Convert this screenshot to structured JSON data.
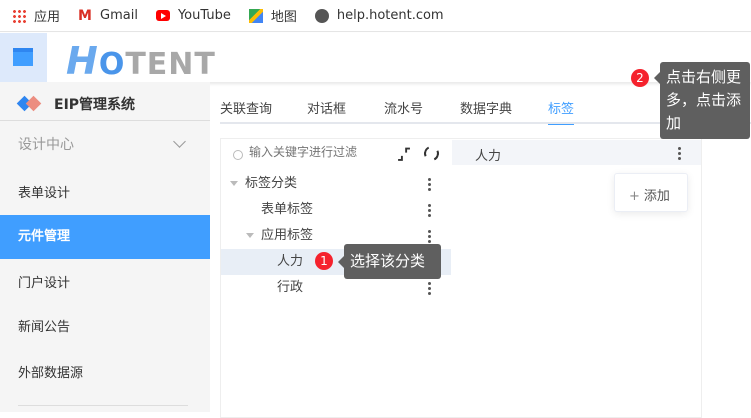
{
  "bookmarks": [
    {
      "label": "应用",
      "icon": "apps-grid-icon"
    },
    {
      "label": "Gmail",
      "icon": "gmail-icon"
    },
    {
      "label": "YouTube",
      "icon": "youtube-icon"
    },
    {
      "label": "地图",
      "icon": "maps-icon"
    },
    {
      "label": "help.hotent.com",
      "icon": "globe-icon"
    }
  ],
  "header": {
    "logo": "HOTENT"
  },
  "sidebar": {
    "system_name": "EIP管理系统",
    "group": "设计中心",
    "items": [
      {
        "label": "表单设计"
      },
      {
        "label": "元件管理",
        "active": true
      },
      {
        "label": "门户设计"
      },
      {
        "label": "新闻公告"
      },
      {
        "label": "外部数据源"
      }
    ]
  },
  "tabs": [
    {
      "label": "关联查询"
    },
    {
      "label": "对话框"
    },
    {
      "label": "流水号"
    },
    {
      "label": "数据字典"
    },
    {
      "label": "标签",
      "active": true
    }
  ],
  "tree": {
    "search_placeholder": "输入关键字进行过滤",
    "nodes": [
      {
        "label": "标签分类",
        "level": 0
      },
      {
        "label": "表单标签",
        "level": 1
      },
      {
        "label": "应用标签",
        "level": 1
      },
      {
        "label": "人力",
        "level": 2,
        "selected": true
      },
      {
        "label": "行政",
        "level": 2
      }
    ]
  },
  "right_panel": {
    "title": "人力",
    "menu_add": "添加"
  },
  "guides": [
    {
      "number": "1",
      "text": "选择该分类"
    },
    {
      "number": "2",
      "text": "点击右侧更多，点击添加"
    }
  ],
  "colors": {
    "accent": "#409eff",
    "badge": "#f5222d",
    "tooltip": "#5f5f5f"
  }
}
